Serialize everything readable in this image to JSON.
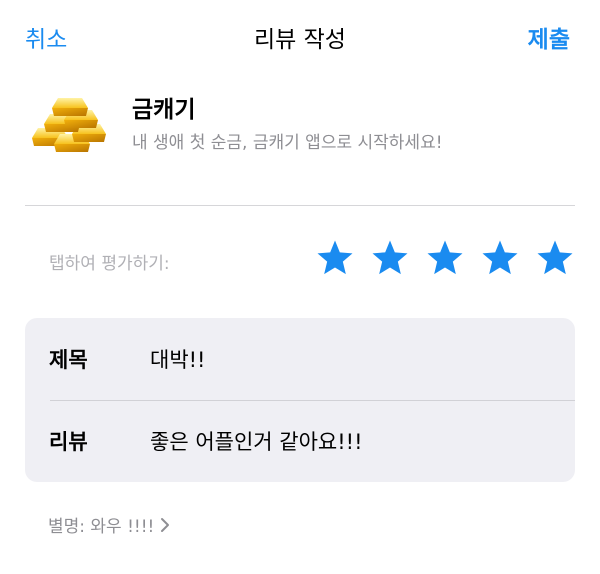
{
  "nav": {
    "cancel_label": "취소",
    "title": "리뷰 작성",
    "submit_label": "제출",
    "accent_color": "#1a8bf0"
  },
  "app": {
    "icon": "gold-bars-icon",
    "name": "금캐기",
    "subtitle": "내 생애 첫 순금, 금캐기 앱으로 시작하세요!"
  },
  "rating": {
    "label": "탭하여 평가하기:",
    "value": 5,
    "max": 5,
    "star_color": "#1a8bf0"
  },
  "review": {
    "title_label": "제목",
    "title_value": "대박!!",
    "body_label": "리뷰",
    "body_value": "좋은 어플인거 같아요!!!"
  },
  "nickname": {
    "text": "별명: 와우 !!!!",
    "icon": "chevron-right-icon"
  }
}
